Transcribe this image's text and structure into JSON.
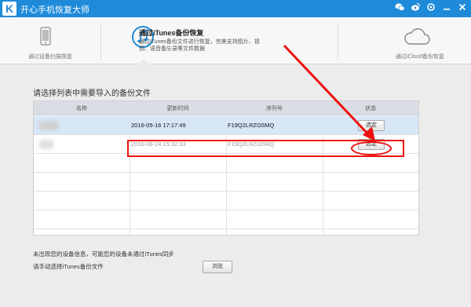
{
  "app": {
    "logo_letter": "K",
    "title": "开心手机恢复大师",
    "window_icons": [
      "wechat-icon",
      "weibo-icon",
      "settings-icon",
      "minimize-icon",
      "close-icon"
    ]
  },
  "modes": [
    {
      "label": "通过设备扫描恢复",
      "icon": "phone-icon"
    },
    {
      "title": "通过iTunes备份恢复",
      "desc": "通过iTunes备份文件进行恢复，完美支持图片、视频、语音备忘录等文件数据",
      "icon": "music-note-icon",
      "active": true
    },
    {
      "label": "通过iCloud备份恢复",
      "icon": "cloud-icon"
    }
  ],
  "section_title": "请选择列表中需要导入的备份文件",
  "table": {
    "headers": [
      "名称",
      "更新时间",
      "序列号",
      "状态"
    ],
    "rows": [
      {
        "time": "2016-05-16 17:17:49",
        "serial": "F19Q2LRZG5MQ",
        "status": "选定",
        "selected": true
      },
      {
        "time": "2016-06-24 15:32:33",
        "serial": "F19Q2LRZG5MQ",
        "status": "选定",
        "selected": false
      }
    ]
  },
  "footer": {
    "note": "未出现您的设备信息，可能您的设备未通过iTunes同步",
    "manual": "请手动选择iTunes备份文件",
    "browse_label": "浏览"
  },
  "colors": {
    "titlebar": "#1e8ad9",
    "annotation": "#e11111",
    "selected_row": "#d7e6f7"
  }
}
